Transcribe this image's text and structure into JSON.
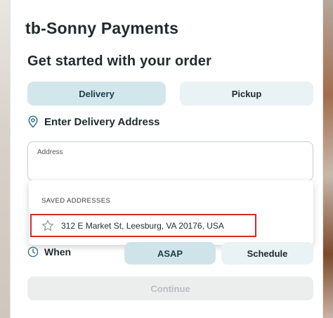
{
  "header": {
    "title": "tb-Sonny Payments",
    "subtitle": "Get started with your order"
  },
  "order_type": {
    "options": [
      "Delivery",
      "Pickup"
    ],
    "selected": "Delivery"
  },
  "address_section": {
    "heading": "Enter Delivery Address",
    "input_label": "Address",
    "input_value": ""
  },
  "saved_addresses": {
    "heading": "SAVED ADDRESSES",
    "items": [
      "312 E Market St, Leesburg, VA 20176, USA"
    ]
  },
  "timing": {
    "label": "When",
    "options": [
      "ASAP",
      "Schedule"
    ],
    "selected": "ASAP"
  },
  "actions": {
    "continue_label": "Continue",
    "continue_enabled": false
  },
  "icons": {
    "address": "location-pin-icon",
    "saved_item": "star-icon",
    "when": "clock-icon"
  },
  "colors": {
    "accent": "#d2e7ec",
    "accent_dark": "#2a6b7c",
    "highlight_border": "#d12c2c",
    "disabled_bg": "#eceeee"
  }
}
